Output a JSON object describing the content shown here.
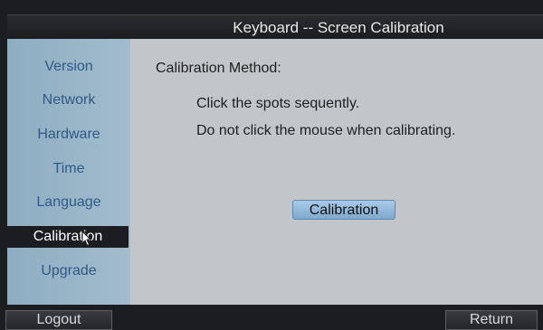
{
  "window": {
    "title": "Keyboard -- Screen Calibration"
  },
  "sidebar": {
    "items": [
      {
        "label": "Version"
      },
      {
        "label": "Network"
      },
      {
        "label": "Hardware"
      },
      {
        "label": "Time"
      },
      {
        "label": "Language"
      },
      {
        "label": "Calibration",
        "active": true
      },
      {
        "label": "Upgrade"
      }
    ]
  },
  "main": {
    "method_label": "Calibration Method:",
    "instruction_1": "Click the spots sequently.",
    "instruction_2": "Do not click the mouse when calibrating.",
    "calibration_button": "Calibration"
  },
  "footer": {
    "logout_label": "Logout",
    "return_label": "Return"
  },
  "colors": {
    "sidebar_text": "#2f5a86",
    "content_bg": "#c2c6c9",
    "button_blue": "#7fa9cf",
    "dark_bg": "#1b1d20"
  },
  "icons": {
    "pointer": "mouse-pointer-icon"
  }
}
